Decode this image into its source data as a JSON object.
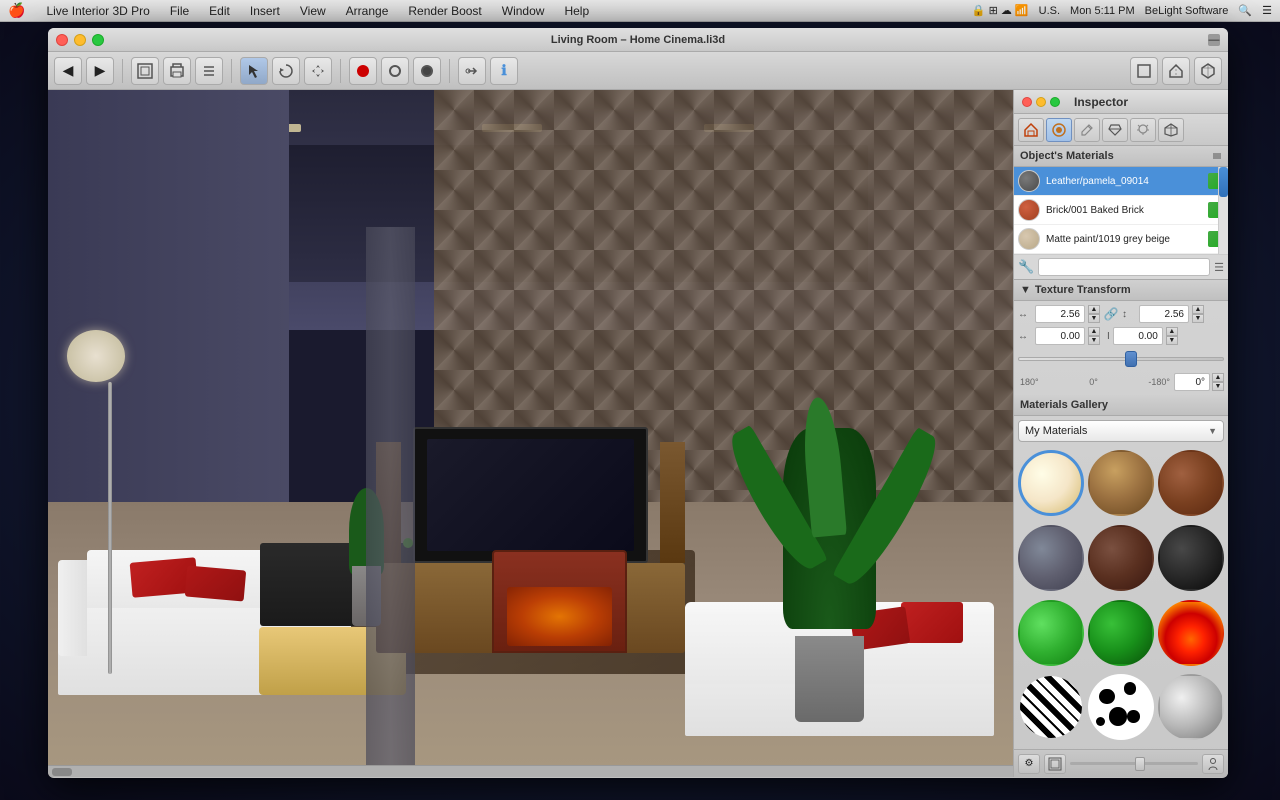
{
  "menubar": {
    "apple": "🍎",
    "items": [
      "Live Interior 3D Pro",
      "File",
      "Edit",
      "Insert",
      "View",
      "Arrange",
      "Render Boost",
      "Window",
      "Help"
    ],
    "right": {
      "status_icons": "🔒 M4 ☁ 📶",
      "locale": "U.S.",
      "time": "Mon 5:11 PM",
      "brand": "BeLight Software",
      "search": "🔍",
      "menu": "☰"
    }
  },
  "window": {
    "title": "Living Room – Home Cinema.li3d",
    "traffic_lights": [
      "red",
      "yellow",
      "green"
    ]
  },
  "inspector": {
    "title": "Inspector",
    "tabs": [
      {
        "label": "🏠",
        "icon": "house-icon"
      },
      {
        "label": "●",
        "icon": "material-icon"
      },
      {
        "label": "✏️",
        "icon": "edit-icon"
      },
      {
        "label": "💎",
        "icon": "gem-icon"
      },
      {
        "label": "💡",
        "icon": "light-icon"
      },
      {
        "label": "🏗",
        "icon": "object-icon"
      }
    ],
    "objects_materials_label": "Object's Materials",
    "materials": [
      {
        "name": "Leather/pamela_09014",
        "color": "#5a5a5a",
        "selected": true
      },
      {
        "name": "Brick/001 Baked Brick",
        "color": "#c04020"
      },
      {
        "name": "Matte paint/1019 grey beige",
        "color": "#c8b89a"
      }
    ],
    "texture_transform": {
      "label": "Texture Transform",
      "width_label": "↔",
      "width_value": "2.56",
      "height_label": "↕",
      "height_value": "2.56",
      "offset_x_label": "↔",
      "offset_x_value": "0.00",
      "offset_y_label": "↕",
      "offset_y_value": "0.00",
      "rotation_label": "0°",
      "rotation_min": "180°",
      "rotation_zero": "0°",
      "rotation_max": "-180°",
      "link_icon": "🔗"
    },
    "gallery": {
      "label": "Materials Gallery",
      "dropdown_value": "My Materials",
      "swatches": [
        {
          "type": "cream",
          "label": "Cream"
        },
        {
          "type": "wood",
          "label": "Wood"
        },
        {
          "type": "brick",
          "label": "Brick"
        },
        {
          "type": "stone",
          "label": "Stone"
        },
        {
          "type": "darkwood",
          "label": "Dark Wood"
        },
        {
          "type": "black",
          "label": "Black"
        },
        {
          "type": "green-bright",
          "label": "Bright Green"
        },
        {
          "type": "green-dark",
          "label": "Dark Green"
        },
        {
          "type": "fire",
          "label": "Fire"
        },
        {
          "type": "zebra",
          "label": "Zebra"
        },
        {
          "type": "spots",
          "label": "Spots"
        },
        {
          "type": "metal",
          "label": "Metal"
        }
      ]
    }
  },
  "toolbar": {
    "back_label": "◀",
    "forward_label": "▶",
    "tools": [
      "🏠",
      "📋",
      "☰",
      "▶",
      "⊙",
      "⬤",
      "⬤"
    ],
    "right_tools": [
      "⚙",
      "ℹ",
      "⬛",
      "🏠",
      "🏗"
    ]
  },
  "viewport": {
    "scrollbar_label": "⚌"
  }
}
